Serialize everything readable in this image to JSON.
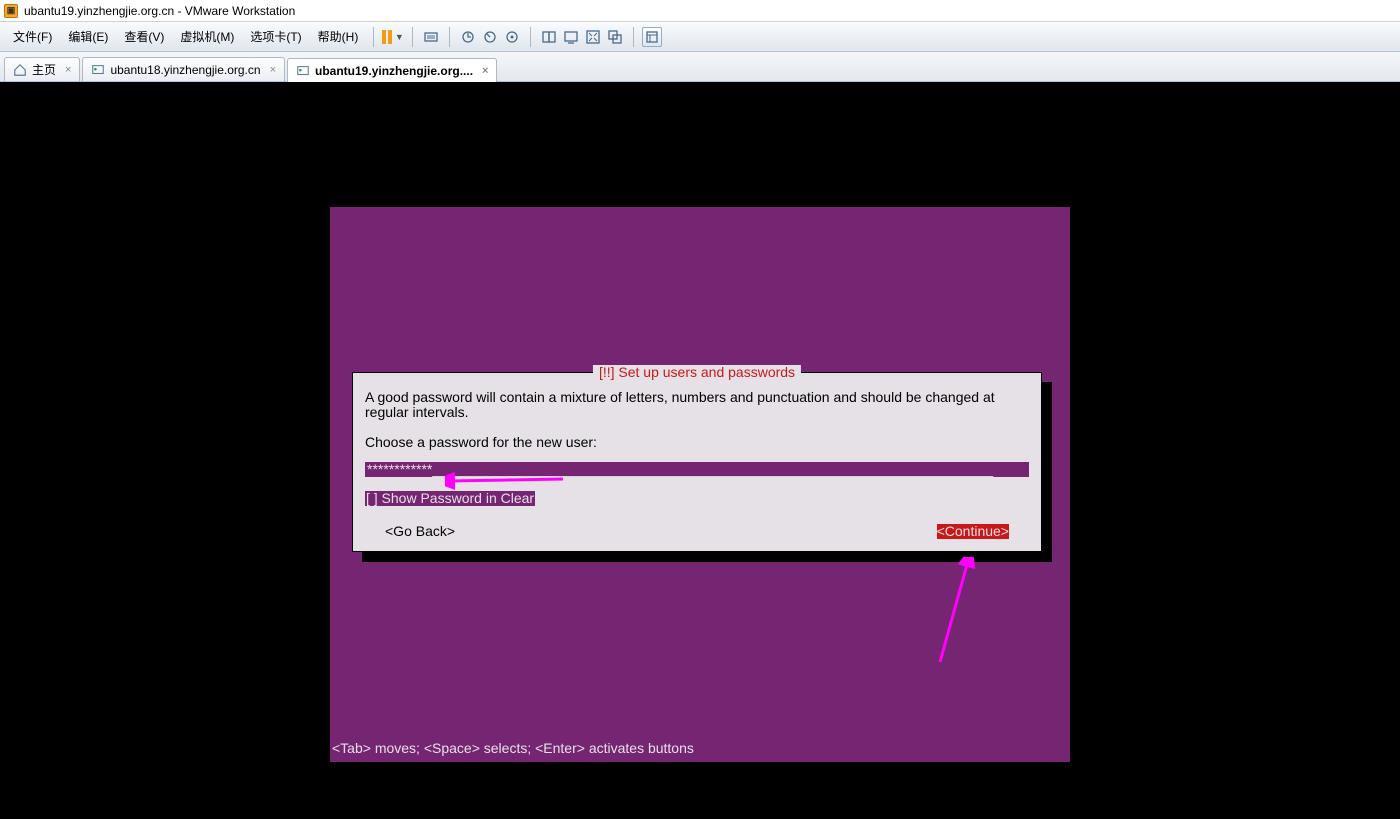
{
  "window": {
    "title": "ubantu19.yinzhengjie.org.cn - VMware Workstation"
  },
  "menus": {
    "file": "文件(F)",
    "edit": "编辑(E)",
    "view": "查看(V)",
    "vm": "虚拟机(M)",
    "tabs": "选项卡(T)",
    "help": "帮助(H)"
  },
  "tabs": {
    "home": "主页",
    "tab1": "ubantu18.yinzhengjie.org.cn",
    "tab2": "ubantu19.yinzhengjie.org...."
  },
  "installer": {
    "title": "[!!] Set up users and passwords",
    "body1": "A good password will contain a mixture of letters, numbers and punctuation and should be changed at regular intervals.",
    "body2": "Choose a password for the new user:",
    "password_mask": "************",
    "show_pwd": "[ ] Show Password in Clear",
    "go_back": "<Go Back>",
    "continue": "<Continue>"
  },
  "footer": "<Tab> moves; <Space> selects; <Enter> activates buttons"
}
